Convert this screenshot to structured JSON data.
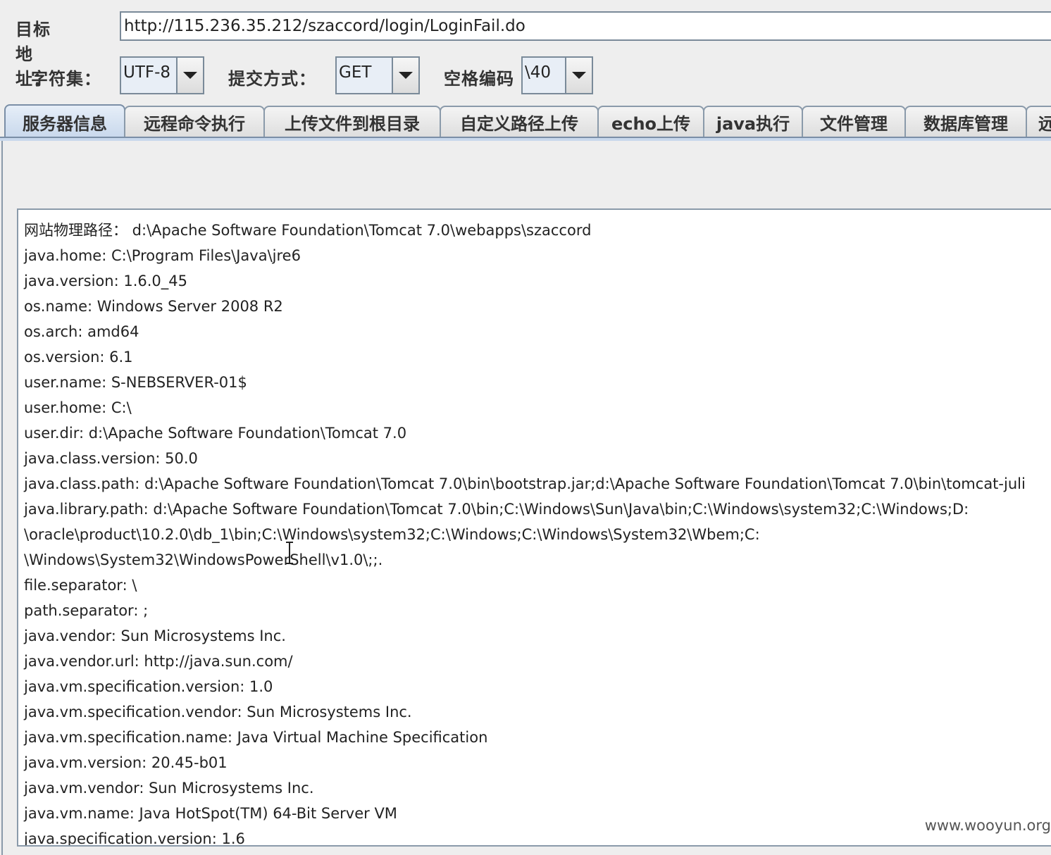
{
  "target": {
    "label": "目标地址：",
    "url": "http://115.236.35.212/szaccord/login/LoginFail.do"
  },
  "options": {
    "charset_label": "字符集：",
    "charset_value": "UTF-8",
    "method_label": "提交方式：",
    "method_value": "GET",
    "space_label": "空格编码",
    "space_value": "\\40"
  },
  "tabs": [
    {
      "label": "服务器信息",
      "active": true
    },
    {
      "label": "远程命令执行"
    },
    {
      "label": "上传文件到根目录"
    },
    {
      "label": "自定义路径上传"
    },
    {
      "label": "echo上传"
    },
    {
      "label": "java执行"
    },
    {
      "label": "文件管理"
    },
    {
      "label": "数据库管理"
    },
    {
      "label": "远"
    }
  ],
  "info_lines": [
    "网站物理路径： d:\\Apache Software Foundation\\Tomcat 7.0\\webapps\\szaccord",
    "java.home: C:\\Program Files\\Java\\jre6",
    "java.version: 1.6.0_45",
    "os.name: Windows Server 2008 R2",
    "os.arch: amd64",
    "os.version: 6.1",
    "user.name: S-NEBSERVER-01$",
    "user.home: C:\\",
    "user.dir: d:\\Apache Software Foundation\\Tomcat 7.0",
    "java.class.version: 50.0",
    "java.class.path: d:\\Apache Software Foundation\\Tomcat 7.0\\bin\\bootstrap.jar;d:\\Apache Software Foundation\\Tomcat 7.0\\bin\\tomcat-juli",
    "java.library.path: d:\\Apache Software Foundation\\Tomcat 7.0\\bin;C:\\Windows\\Sun\\Java\\bin;C:\\Windows\\system32;C:\\Windows;D:",
    "\\oracle\\product\\10.2.0\\db_1\\bin;C:\\Windows\\system32;C:\\Windows;C:\\Windows\\System32\\Wbem;C:",
    "\\Windows\\System32\\WindowsPowerShell\\v1.0\\;;.",
    "file.separator: \\",
    "path.separator: ;",
    "java.vendor: Sun Microsystems Inc.",
    "java.vendor.url: http://java.sun.com/",
    "java.vm.specification.version: 1.0",
    "java.vm.specification.vendor: Sun Microsystems Inc.",
    "java.vm.specification.name: Java Virtual Machine Specification",
    "java.vm.version: 20.45-b01",
    "java.vm.vendor: Sun Microsystems Inc.",
    "java.vm.name: Java HotSpot(TM) 64-Bit Server VM",
    "java.specification.version: 1.6"
  ],
  "watermark": "www.wooyun.org",
  "cursor_icon": "text-cursor-icon"
}
